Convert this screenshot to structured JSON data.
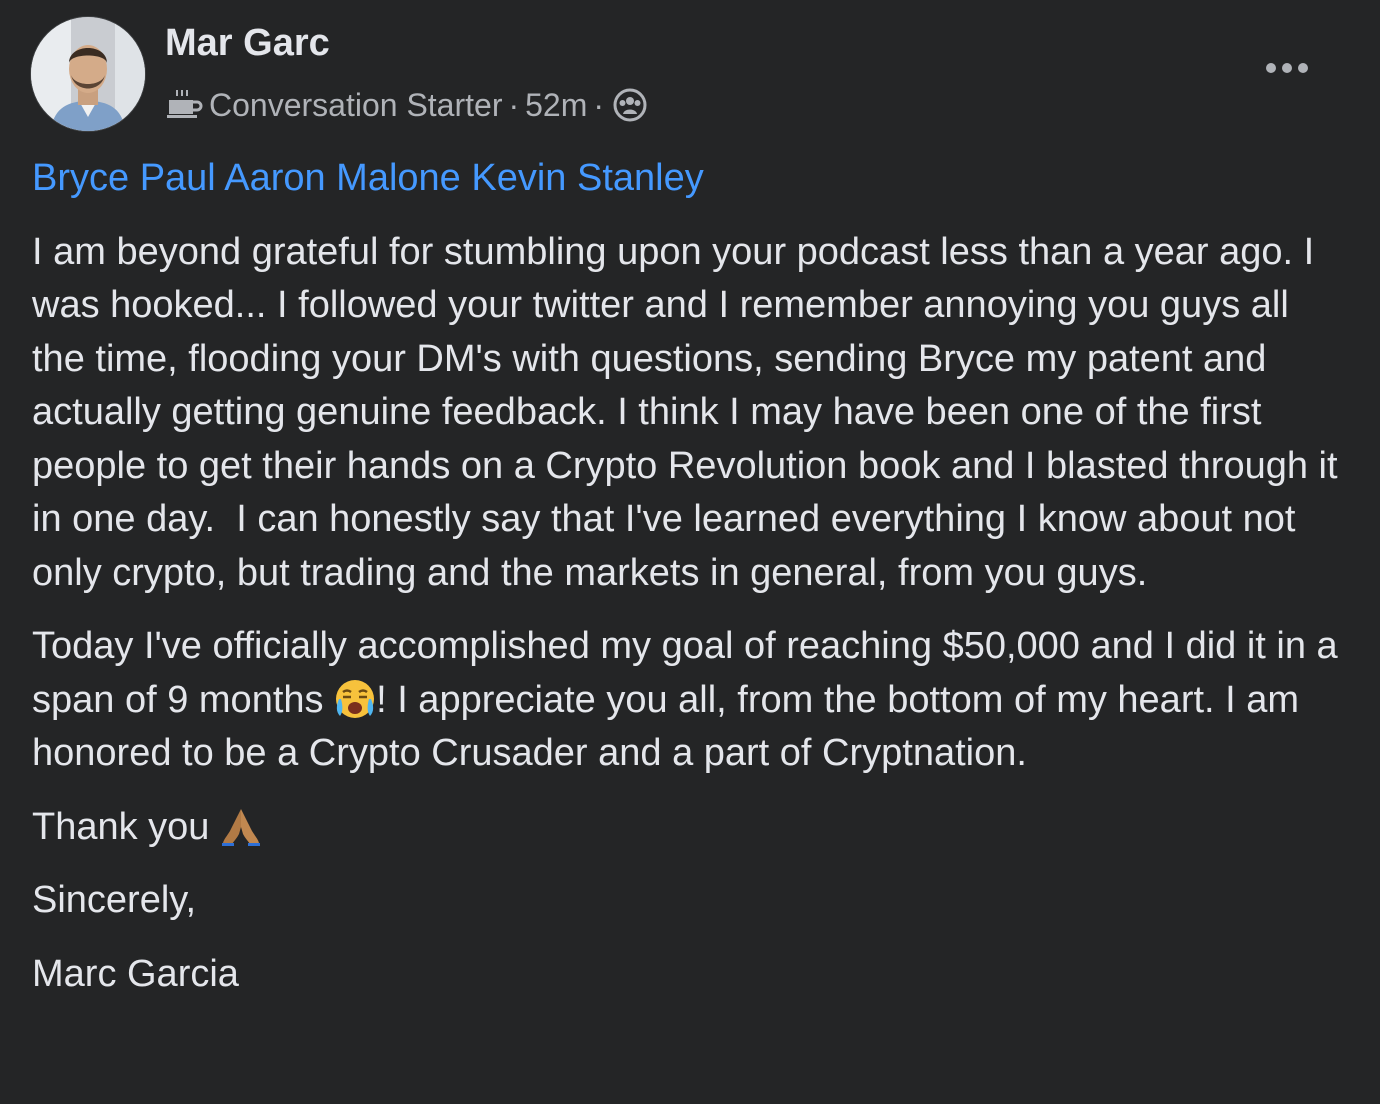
{
  "post": {
    "author": "Mar Garc",
    "badge_icon": "coffee-cup-icon",
    "badge_label": "Conversation Starter",
    "separator": "·",
    "timestamp": "52m",
    "audience_icon": "group-audience-icon",
    "more_icon": "more-options-icon",
    "mentions": [
      "Bryce Paul",
      "Aaron Malone",
      "Kevin Stanley"
    ],
    "paragraph1": "I am beyond grateful for stumbling upon your podcast less than a year ago. I was hooked... I followed your twitter and I remember annoying you guys all the time, flooding your DM's with questions, sending Bryce my patent and actually getting genuine feedback. I think I may have been one of the first people to get their hands on a Crypto Revolution book and I blasted through it in one day.  I can honestly say that I've learned everything I know about not only crypto, but trading and the markets in general, from you guys.",
    "paragraph2_a": "Today I've officially accomplished my goal of reaching $50,000 and I did it in a span of 9 months ",
    "paragraph2_emoji": "loudly-crying-face-emoji",
    "paragraph2_b": "! I appreciate you all, from the bottom of my heart. I am honored to be a Crypto Crusader and a part of Cryptnation.",
    "thanks": "Thank you ",
    "thanks_emoji": "folded-hands-emoji",
    "closing": "Sincerely,",
    "signature": "Marc Garcia"
  },
  "colors": {
    "background": "#242526",
    "text_primary": "#e4e6eb",
    "text_secondary": "#b0b3b8",
    "link": "#4599ff"
  }
}
